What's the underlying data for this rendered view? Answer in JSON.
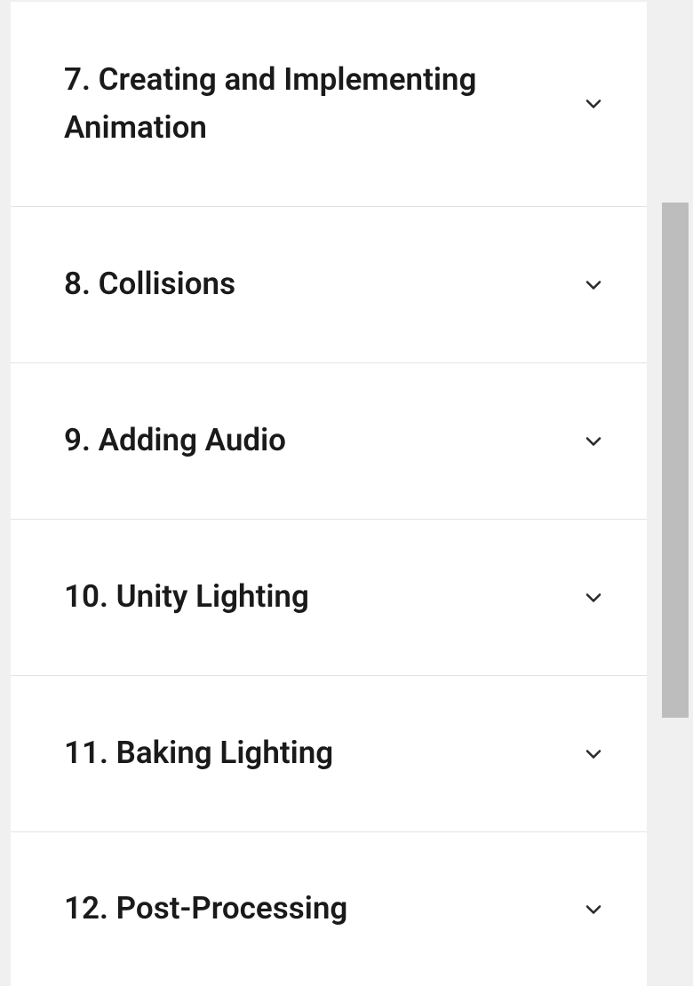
{
  "sections": [
    {
      "number": "7",
      "title": "Creating and Implementing Animation"
    },
    {
      "number": "8",
      "title": "Collisions"
    },
    {
      "number": "9",
      "title": "Adding Audio"
    },
    {
      "number": "10",
      "title": "Unity Lighting"
    },
    {
      "number": "11",
      "title": "Baking Lighting"
    },
    {
      "number": "12",
      "title": "Post-Processing"
    }
  ]
}
